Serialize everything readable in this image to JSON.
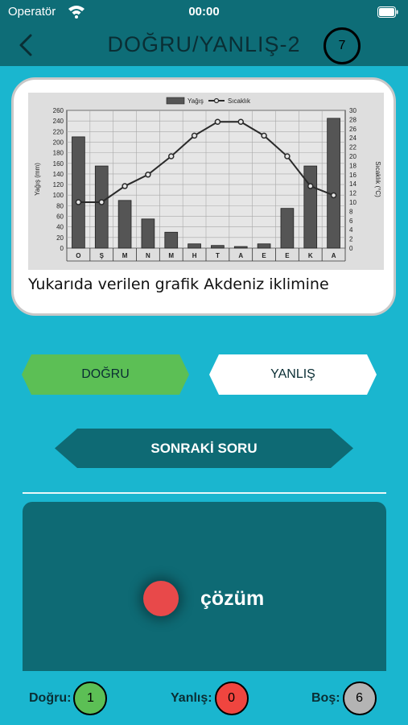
{
  "status_bar": {
    "carrier": "Operatör",
    "time": "00:00"
  },
  "header": {
    "title": "DOĞRU/YANLIŞ-2",
    "question_number": "7"
  },
  "question": {
    "text": "Yukarıda verilen grafik Akdeniz iklimine"
  },
  "answers": {
    "true_label": "DOĞRU",
    "false_label": "YANLIŞ",
    "selected": "DOĞRU"
  },
  "next_label": "SONRAKİ SORU",
  "solution": {
    "label": "çözüm"
  },
  "score": {
    "correct_label": "Doğru:",
    "correct": "1",
    "wrong_label": "Yanlış:",
    "wrong": "0",
    "empty_label": "Boş:",
    "empty": "6"
  },
  "colors": {
    "header": "#0e6d77",
    "background": "#1ab6cf",
    "correct": "#5cbf55",
    "wrong": "#f0453f",
    "empty": "#b4b4b4"
  },
  "icons": {
    "back": "chevron-left-icon",
    "wifi": "wifi-icon",
    "battery": "battery-icon",
    "solution": "red-dot-icon"
  },
  "chart_data": {
    "type": "bar",
    "categories": [
      "O",
      "Ş",
      "M",
      "N",
      "M",
      "H",
      "T",
      "A",
      "E",
      "E",
      "K",
      "A"
    ],
    "series": [
      {
        "name": "Yağış",
        "type": "bar",
        "axis": "left",
        "values": [
          210,
          155,
          90,
          55,
          30,
          8,
          5,
          3,
          8,
          75,
          155,
          245
        ]
      },
      {
        "name": "Sıcaklık",
        "type": "line",
        "axis": "right",
        "values": [
          10,
          10,
          13.5,
          16,
          20,
          24.5,
          27.5,
          27.5,
          24.5,
          20,
          13.5,
          11.5
        ]
      }
    ],
    "ylabel": "Yağış (mm)",
    "y2label": "Sıcaklık (°C)",
    "ylim": [
      0,
      260
    ],
    "y2lim": [
      0,
      30
    ],
    "yticks": [
      "0",
      "20",
      "40",
      "60",
      "80",
      "100",
      "120",
      "140",
      "160",
      "180",
      "200",
      "220",
      "240",
      "260"
    ],
    "y2ticks": [
      "0",
      "2",
      "4",
      "6",
      "8",
      "10",
      "12",
      "14",
      "16",
      "18",
      "20",
      "22",
      "24",
      "26",
      "28",
      "30"
    ],
    "legend": [
      "Yağış",
      "Sıcaklık"
    ],
    "legend_position": "top-center",
    "grid": true
  }
}
